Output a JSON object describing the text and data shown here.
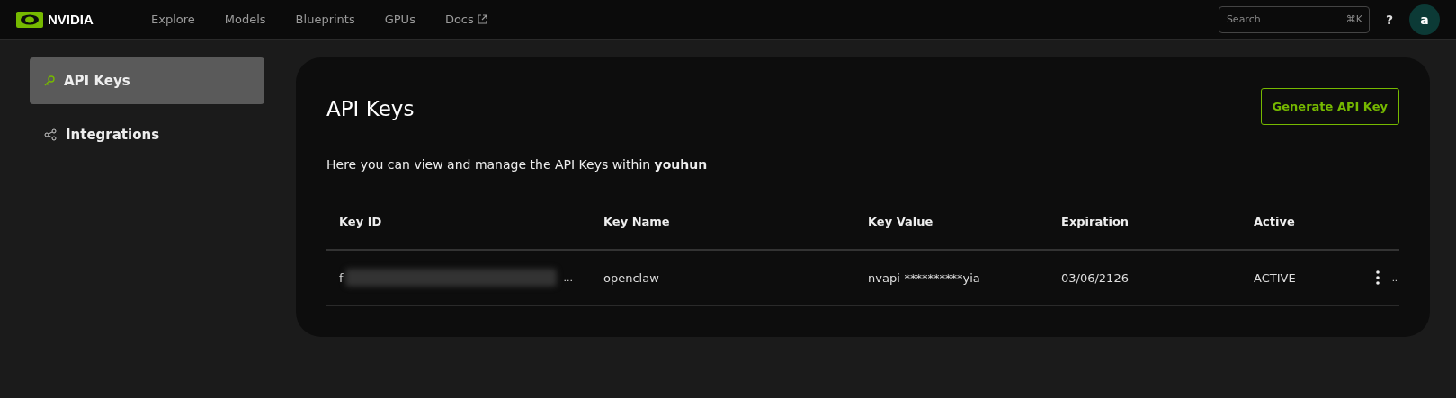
{
  "topbar": {
    "logo": "NVIDIA",
    "nav": [
      {
        "label": "Explore",
        "external": false
      },
      {
        "label": "Models",
        "external": false
      },
      {
        "label": "Blueprints",
        "external": false
      },
      {
        "label": "GPUs",
        "external": false
      },
      {
        "label": "Docs",
        "external": true
      }
    ],
    "search": {
      "placeholder": "Search",
      "shortcut": "⌘K"
    },
    "help": "?",
    "avatar": "a"
  },
  "sidebar": {
    "items": [
      {
        "label": "API Keys",
        "kind": "key",
        "selected": true
      },
      {
        "label": "Integrations",
        "kind": "share",
        "selected": false
      }
    ]
  },
  "main": {
    "title": "API Keys",
    "button": "Generate API Key",
    "description": "Here you can view and manage the API Keys within **youhun**",
    "table": {
      "columns": [
        "Key ID",
        "Key Name",
        "Key Value",
        "Expiration",
        "Active"
      ],
      "rows": [
        {
          "key_id": "f",
          "key_id_redacted": true,
          "key_id_more": "...",
          "key_name": "openclaw",
          "key_value": "nvapi-**********yia",
          "expiration": "03/06/2126",
          "active": "ACTIVE",
          "trailing": ".."
        }
      ]
    }
  }
}
